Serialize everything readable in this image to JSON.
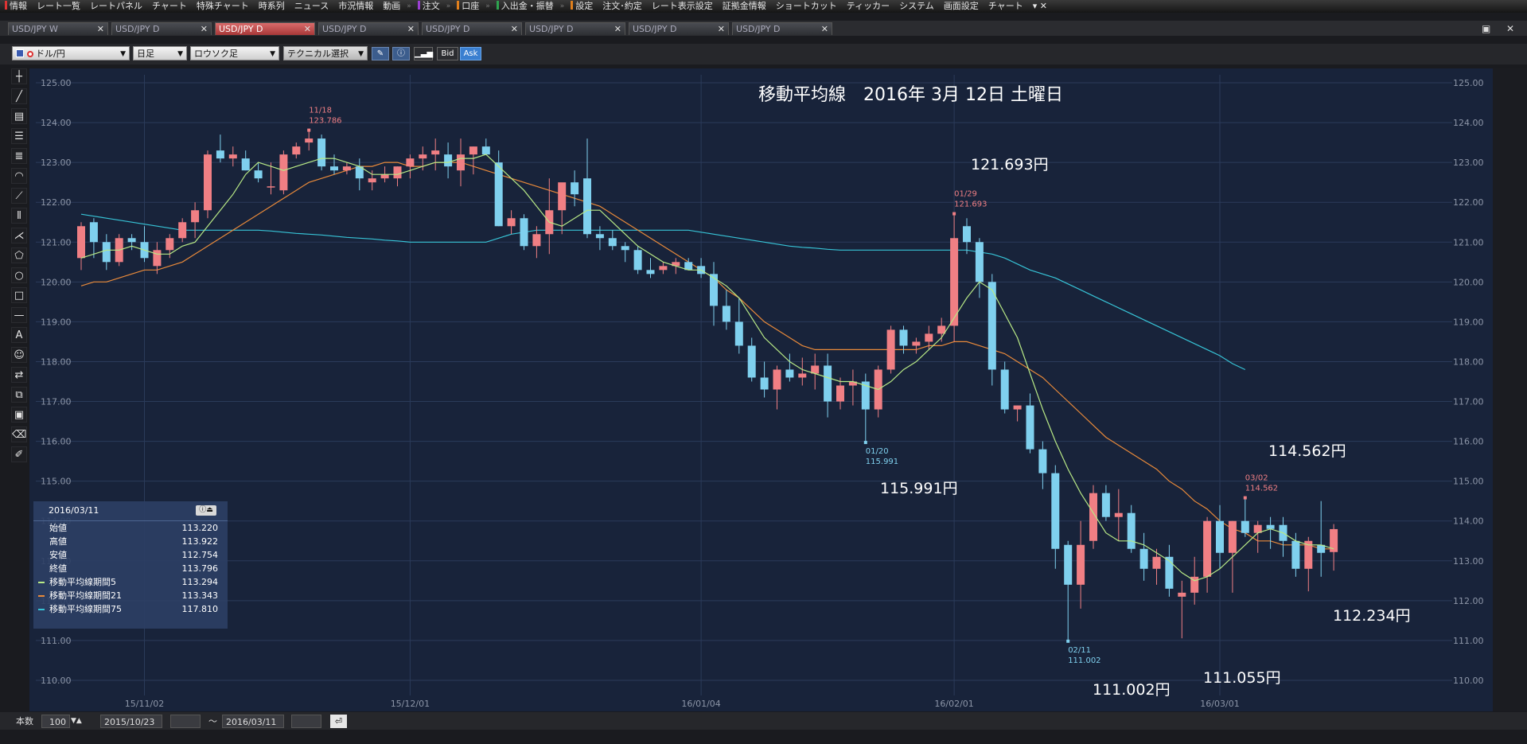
{
  "menu": {
    "items": [
      "情報",
      "レート一覧",
      "レートパネル",
      "チャート",
      "特殊チャート",
      "時系列",
      "ニュース",
      "市況情報",
      "動画",
      "注文",
      "口座",
      "入出金・振替",
      "設定",
      "注文･約定",
      "レート表示設定",
      "証拠金情報",
      "ショートカット",
      "ティッカー",
      "システム",
      "画面設定",
      "チャート"
    ]
  },
  "tabs": [
    {
      "label": "USD/JPY W",
      "active": false
    },
    {
      "label": "USD/JPY D",
      "active": false
    },
    {
      "label": "USD/JPY D",
      "active": true
    },
    {
      "label": "USD/JPY D",
      "active": false
    },
    {
      "label": "USD/JPY D",
      "active": false
    },
    {
      "label": "USD/JPY D",
      "active": false
    },
    {
      "label": "USD/JPY D",
      "active": false
    },
    {
      "label": "USD/JPY D",
      "active": false
    }
  ],
  "toolbar": {
    "pair": "ドル/円",
    "period": "日足",
    "chart_style": "ロウソク足",
    "technical": "テクニカル選択",
    "bid": "Bid",
    "ask": "Ask"
  },
  "colors": {
    "up": "#f07f84",
    "down": "#7fd0ee",
    "ma5": "#b8e986",
    "ma21": "#e98a3a",
    "ma75": "#37c3d6",
    "grid": "#2b3b5a",
    "axis_text": "#8d96a8"
  },
  "chart_data": {
    "type": "candlestick",
    "title": "移動平均線　2016年 3月 12日 土曜日",
    "ylim": [
      109.7,
      125.2
    ],
    "y_ticks": [
      "110.00",
      "111.00",
      "112.00",
      "113.00",
      "114.00",
      "115.00",
      "116.00",
      "117.00",
      "118.00",
      "119.00",
      "120.00",
      "121.00",
      "122.00",
      "123.00",
      "124.00",
      "125.00"
    ],
    "x_ticks": [
      {
        "label": "15/11/02",
        "index": 5
      },
      {
        "label": "15/12/01",
        "index": 26
      },
      {
        "label": "16/01/04",
        "index": 49
      },
      {
        "label": "16/02/01",
        "index": 69
      },
      {
        "label": "16/03/01",
        "index": 90
      }
    ],
    "ohlc": [
      [
        120.6,
        121.5,
        120.3,
        121.4
      ],
      [
        121.5,
        121.6,
        120.6,
        121.0
      ],
      [
        121.0,
        121.2,
        120.3,
        120.5
      ],
      [
        120.5,
        121.2,
        120.4,
        121.1
      ],
      [
        121.1,
        121.2,
        120.8,
        121.0
      ],
      [
        121.0,
        121.4,
        120.5,
        120.6
      ],
      [
        120.4,
        121.0,
        120.2,
        120.8
      ],
      [
        120.8,
        121.2,
        120.6,
        121.1
      ],
      [
        121.1,
        121.6,
        121.0,
        121.5
      ],
      [
        121.5,
        122.0,
        121.1,
        121.8
      ],
      [
        121.8,
        123.3,
        121.6,
        123.2
      ],
      [
        123.3,
        123.7,
        123.0,
        123.1
      ],
      [
        123.1,
        123.4,
        122.9,
        123.2
      ],
      [
        123.1,
        123.3,
        122.8,
        122.8
      ],
      [
        122.8,
        123.0,
        122.5,
        122.6
      ],
      [
        122.4,
        123.0,
        122.2,
        122.4
      ],
      [
        122.3,
        123.3,
        122.2,
        123.2
      ],
      [
        123.2,
        123.5,
        123.1,
        123.4
      ],
      [
        123.5,
        123.79,
        123.3,
        123.6
      ],
      [
        123.6,
        123.7,
        122.8,
        122.9
      ],
      [
        122.9,
        123.2,
        122.7,
        122.8
      ],
      [
        122.8,
        123.0,
        122.7,
        122.9
      ],
      [
        122.9,
        123.1,
        122.3,
        122.6
      ],
      [
        122.5,
        122.8,
        122.3,
        122.6
      ],
      [
        122.6,
        122.9,
        122.5,
        122.7
      ],
      [
        122.6,
        122.9,
        122.4,
        122.9
      ],
      [
        122.9,
        123.2,
        122.6,
        123.1
      ],
      [
        123.1,
        123.4,
        122.8,
        123.2
      ],
      [
        123.2,
        123.6,
        122.8,
        123.3
      ],
      [
        123.2,
        123.5,
        122.6,
        122.9
      ],
      [
        122.8,
        123.6,
        122.4,
        123.2
      ],
      [
        123.2,
        123.4,
        122.7,
        123.4
      ],
      [
        123.4,
        123.6,
        123.2,
        123.2
      ],
      [
        123.0,
        123.3,
        121.4,
        121.4
      ],
      [
        121.4,
        121.8,
        121.2,
        121.6
      ],
      [
        121.6,
        121.7,
        120.8,
        120.9
      ],
      [
        120.9,
        121.4,
        120.6,
        121.2
      ],
      [
        121.2,
        122.6,
        120.7,
        121.8
      ],
      [
        121.8,
        122.4,
        121.2,
        122.5
      ],
      [
        122.5,
        122.8,
        121.9,
        122.2
      ],
      [
        122.6,
        123.6,
        121.1,
        121.2
      ],
      [
        121.2,
        121.4,
        120.8,
        121.1
      ],
      [
        121.1,
        121.3,
        120.8,
        120.9
      ],
      [
        120.9,
        121.0,
        120.5,
        120.8
      ],
      [
        120.8,
        120.9,
        120.2,
        120.3
      ],
      [
        120.3,
        120.6,
        120.1,
        120.2
      ],
      [
        120.3,
        120.5,
        120.2,
        120.4
      ],
      [
        120.4,
        120.6,
        120.2,
        120.5
      ],
      [
        120.5,
        120.6,
        120.3,
        120.3
      ],
      [
        120.4,
        120.6,
        120.1,
        120.2
      ],
      [
        120.2,
        120.5,
        118.9,
        119.4
      ],
      [
        119.4,
        119.8,
        118.8,
        119.0
      ],
      [
        119.0,
        119.6,
        118.2,
        118.4
      ],
      [
        118.4,
        118.6,
        117.5,
        117.6
      ],
      [
        117.6,
        118.0,
        117.1,
        117.3
      ],
      [
        117.3,
        117.9,
        116.8,
        117.8
      ],
      [
        117.8,
        118.2,
        117.5,
        117.6
      ],
      [
        117.6,
        118.1,
        117.4,
        117.7
      ],
      [
        117.7,
        118.2,
        117.3,
        117.9
      ],
      [
        117.9,
        118.2,
        116.6,
        117.0
      ],
      [
        117.0,
        117.6,
        116.8,
        117.4
      ],
      [
        117.4,
        117.8,
        116.9,
        117.5
      ],
      [
        117.5,
        117.7,
        115.991,
        116.8
      ],
      [
        116.8,
        117.9,
        116.6,
        117.8
      ],
      [
        117.8,
        118.9,
        117.7,
        118.8
      ],
      [
        118.8,
        118.9,
        118.2,
        118.4
      ],
      [
        118.4,
        118.6,
        118.2,
        118.5
      ],
      [
        118.5,
        118.9,
        118.3,
        118.7
      ],
      [
        118.7,
        119.1,
        118.5,
        118.9
      ],
      [
        118.9,
        121.693,
        118.5,
        121.1
      ],
      [
        121.4,
        121.6,
        120.7,
        121.0
      ],
      [
        121.0,
        121.1,
        119.6,
        120.0
      ],
      [
        120.0,
        120.2,
        117.4,
        117.8
      ],
      [
        117.8,
        118.0,
        116.7,
        116.8
      ],
      [
        116.8,
        116.9,
        116.5,
        116.9
      ],
      [
        116.9,
        117.2,
        115.7,
        115.8
      ],
      [
        115.8,
        116.0,
        114.8,
        115.2
      ],
      [
        115.2,
        115.4,
        112.8,
        113.3
      ],
      [
        113.4,
        113.5,
        111.002,
        112.4
      ],
      [
        112.4,
        114.0,
        111.8,
        113.4
      ],
      [
        113.5,
        114.9,
        113.3,
        114.7
      ],
      [
        114.7,
        114.9,
        114.0,
        114.1
      ],
      [
        114.1,
        114.8,
        113.5,
        114.2
      ],
      [
        114.2,
        114.4,
        113.2,
        113.3
      ],
      [
        113.3,
        113.7,
        112.5,
        112.8
      ],
      [
        112.8,
        113.3,
        112.4,
        113.1
      ],
      [
        113.1,
        113.4,
        112.1,
        112.3
      ],
      [
        112.1,
        112.5,
        111.055,
        112.2
      ],
      [
        112.2,
        113.1,
        111.9,
        112.6
      ],
      [
        112.6,
        114.1,
        112.2,
        114.0
      ],
      [
        114.0,
        114.4,
        112.8,
        113.2
      ],
      [
        113.2,
        114.0,
        112.2,
        114.0
      ],
      [
        114.0,
        114.562,
        113.6,
        113.7
      ],
      [
        113.7,
        114.0,
        113.2,
        113.9
      ],
      [
        113.9,
        114.1,
        113.3,
        113.8
      ],
      [
        113.9,
        114.1,
        113.1,
        113.5
      ],
      [
        113.5,
        113.7,
        112.6,
        112.8
      ],
      [
        112.8,
        113.6,
        112.234,
        113.5
      ],
      [
        113.4,
        114.5,
        112.6,
        113.2
      ],
      [
        113.22,
        113.922,
        112.754,
        113.796
      ]
    ],
    "ma5": [
      120.6,
      120.7,
      120.8,
      120.8,
      120.9,
      120.8,
      120.7,
      120.7,
      120.9,
      121.0,
      121.4,
      121.8,
      122.2,
      122.7,
      123.0,
      122.9,
      122.8,
      122.9,
      123.0,
      123.1,
      123.1,
      123.0,
      122.9,
      122.7,
      122.7,
      122.7,
      122.8,
      122.9,
      123.0,
      123.0,
      123.1,
      123.1,
      123.2,
      122.9,
      122.6,
      122.3,
      121.9,
      121.5,
      121.4,
      121.6,
      121.8,
      121.8,
      121.5,
      121.2,
      120.9,
      120.7,
      120.5,
      120.4,
      120.3,
      120.3,
      120.1,
      119.9,
      119.6,
      119.1,
      118.6,
      118.3,
      118.0,
      117.8,
      117.7,
      117.6,
      117.5,
      117.5,
      117.4,
      117.3,
      117.5,
      117.8,
      118.0,
      118.3,
      118.6,
      119.1,
      119.6,
      120.0,
      119.8,
      119.2,
      118.6,
      117.7,
      116.8,
      116.0,
      115.3,
      114.7,
      114.2,
      113.7,
      113.5,
      113.5,
      113.4,
      113.2,
      113.0,
      112.7,
      112.5,
      112.6,
      112.8,
      113.1,
      113.4,
      113.7,
      113.8,
      113.7,
      113.5,
      113.4,
      113.4,
      113.3
    ],
    "ma21": [
      119.9,
      120.0,
      120.0,
      120.1,
      120.2,
      120.3,
      120.3,
      120.4,
      120.5,
      120.7,
      120.9,
      121.1,
      121.3,
      121.5,
      121.7,
      121.9,
      122.1,
      122.3,
      122.5,
      122.6,
      122.7,
      122.8,
      122.9,
      122.9,
      123.0,
      123.0,
      122.9,
      122.9,
      123.0,
      123.0,
      123.0,
      122.9,
      122.8,
      122.7,
      122.6,
      122.5,
      122.4,
      122.3,
      122.2,
      122.1,
      122.0,
      121.9,
      121.7,
      121.5,
      121.3,
      121.1,
      120.9,
      120.7,
      120.5,
      120.3,
      120.1,
      119.8,
      119.6,
      119.3,
      119.0,
      118.8,
      118.6,
      118.4,
      118.3,
      118.3,
      118.3,
      118.3,
      118.3,
      118.3,
      118.3,
      118.3,
      118.3,
      118.4,
      118.4,
      118.5,
      118.5,
      118.4,
      118.3,
      118.2,
      118.0,
      117.8,
      117.6,
      117.3,
      117.0,
      116.7,
      116.4,
      116.1,
      115.9,
      115.7,
      115.5,
      115.3,
      115.0,
      114.8,
      114.5,
      114.3,
      114.0,
      113.8,
      113.7,
      113.5,
      113.5,
      113.4,
      113.4,
      113.4,
      113.3,
      113.3
    ],
    "ma75": [
      121.7,
      121.65,
      121.6,
      121.55,
      121.5,
      121.45,
      121.4,
      121.35,
      121.3,
      121.3,
      121.3,
      121.3,
      121.3,
      121.3,
      121.3,
      121.28,
      121.25,
      121.22,
      121.2,
      121.18,
      121.15,
      121.12,
      121.1,
      121.08,
      121.05,
      121.03,
      121.0,
      121.0,
      121.0,
      121.0,
      121.0,
      121.0,
      121.0,
      121.1,
      121.2,
      121.25,
      121.3,
      121.3,
      121.3,
      121.3,
      121.3,
      121.3,
      121.3,
      121.3,
      121.3,
      121.3,
      121.3,
      121.3,
      121.3,
      121.25,
      121.2,
      121.15,
      121.1,
      121.05,
      121.0,
      120.95,
      120.9,
      120.87,
      120.85,
      120.82,
      120.8,
      120.8,
      120.8,
      120.8,
      120.8,
      120.8,
      120.8,
      120.8,
      120.8,
      120.8,
      120.8,
      120.75,
      120.7,
      120.6,
      120.45,
      120.3,
      120.2,
      120.1,
      119.95,
      119.8,
      119.65,
      119.5,
      119.35,
      119.2,
      119.05,
      118.9,
      118.75,
      118.6,
      118.45,
      118.3,
      118.15,
      117.95,
      117.8
    ],
    "markers": [
      {
        "index": 18,
        "date": "11/18",
        "value": "123.786",
        "color": "#f07f84",
        "pos": "high"
      },
      {
        "index": 62,
        "date": "01/20",
        "value": "115.991",
        "color": "#7fd0ee",
        "pos": "low"
      },
      {
        "index": 69,
        "date": "01/29",
        "value": "121.693",
        "color": "#f07f84",
        "pos": "high"
      },
      {
        "index": 78,
        "date": "02/11",
        "value": "111.002",
        "color": "#7fd0ee",
        "pos": "low"
      },
      {
        "index": 92,
        "date": "03/02",
        "value": "114.562",
        "color": "#f07f84",
        "pos": "high"
      }
    ],
    "annotations": [
      {
        "text": "121.693円",
        "x": 1220,
        "y": 213
      },
      {
        "text": "115.991円",
        "x": 1106,
        "y": 620
      },
      {
        "text": "111.002円",
        "x": 1373,
        "y": 873
      },
      {
        "text": "111.055円",
        "x": 1512,
        "y": 858
      },
      {
        "text": "114.562円",
        "x": 1594,
        "y": 573
      },
      {
        "text": "112.234円",
        "x": 1675,
        "y": 780
      }
    ]
  },
  "data_panel": {
    "date": "2016/03/11",
    "rows": [
      {
        "label": "始値",
        "value": "113.220",
        "color": ""
      },
      {
        "label": "高値",
        "value": "113.922",
        "color": ""
      },
      {
        "label": "安値",
        "value": "112.754",
        "color": ""
      },
      {
        "label": "終値",
        "value": "113.796",
        "color": ""
      },
      {
        "label": "移動平均線期間5",
        "value": "113.294",
        "color": "#b8e986"
      },
      {
        "label": "移動平均線期間21",
        "value": "113.343",
        "color": "#e98a3a"
      },
      {
        "label": "移動平均線期間75",
        "value": "117.810",
        "color": "#37c3d6"
      }
    ]
  },
  "status": {
    "count_label": "本数",
    "count_value": "100",
    "from_date": "2015/10/23",
    "tilde": "～",
    "to_date": "2016/03/11"
  }
}
